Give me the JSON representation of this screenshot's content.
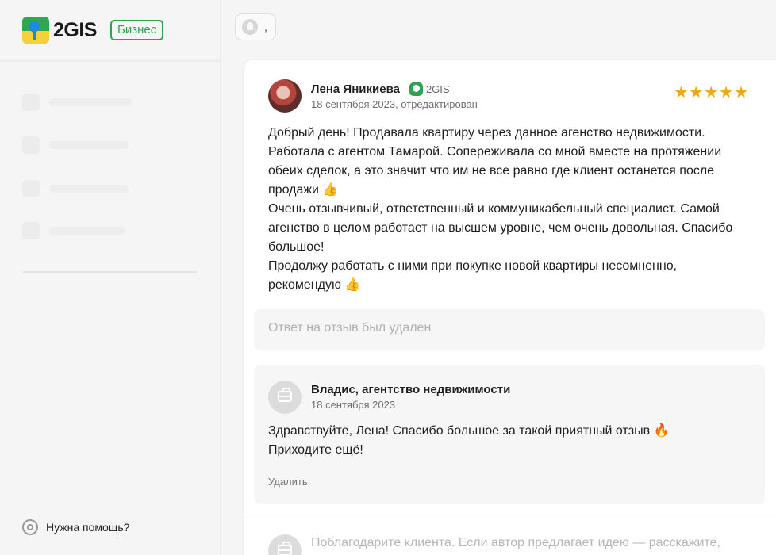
{
  "brand": {
    "logo_text": "2GIS",
    "badge": "Бизнес"
  },
  "sidebar": {
    "help_label": "Нужна помощь?"
  },
  "top_chip": {
    "text": ","
  },
  "review": {
    "author": "Лена Яникиева",
    "source": "2GIS",
    "date": "18 сентября 2023, отредактирован",
    "rating": 5,
    "stars": "★★★★★",
    "paragraphs": [
      "Добрый день! Продавала квартиру через данное агенство недвижимости. Работала с агентом Тамарой. Сопереживала со мной вместе на протяжении обеих сделок, а это значит что им не все равно где клиент останется после продажи 👍",
      "Очень отзывчивый, ответственный и коммуникабельный специалист. Самой агенство в целом работает на высшем уровне, чем очень довольная. Спасибо большое!",
      "Продолжу работать с ними при покупке новой квартиры несомненно, рекомендую 👍"
    ]
  },
  "deleted_reply": {
    "text": "Ответ на отзыв был удален"
  },
  "company_reply": {
    "name": "Владис, агентство недвижимости",
    "date": "18 сентября 2023",
    "lines": [
      "Здравствуйте, Лена! Спасибо большое за такой приятный отзыв 🔥",
      "Приходите ещё!"
    ],
    "delete_label": "Удалить"
  },
  "reply_input": {
    "placeholder": "Поблагодарите клиента. Если автор предлагает идею — расскажите,"
  },
  "colors": {
    "brand_green": "#2ea44f",
    "star": "#f2a60c",
    "muted": "#b0b0b0"
  },
  "icons": {
    "help": "lifebuoy-icon",
    "reply_avatar": "briefcase-icon",
    "source": "2gis-icon"
  }
}
